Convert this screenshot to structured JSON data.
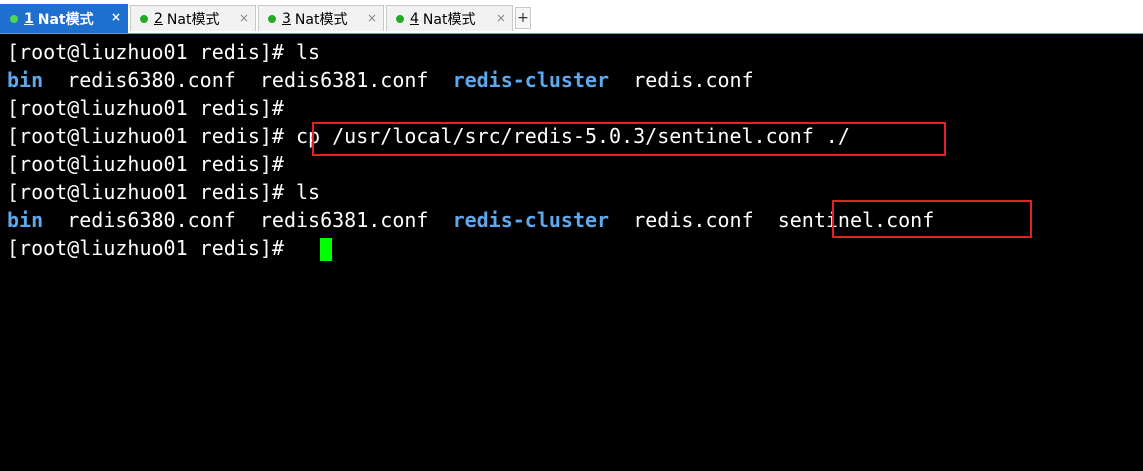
{
  "tabs": [
    {
      "num": "1",
      "label": "Nat模式",
      "dot_color": "#4cd94c",
      "active": true
    },
    {
      "num": "2",
      "label": "Nat模式",
      "dot_color": "#22aa22",
      "active": false
    },
    {
      "num": "3",
      "label": "Nat模式",
      "dot_color": "#22aa22",
      "active": false
    },
    {
      "num": "4",
      "label": "Nat模式",
      "dot_color": "#22aa22",
      "active": false
    }
  ],
  "close_glyph": "×",
  "add_tab_glyph": "+",
  "terminal": {
    "prompt": "[root@liuzhuo01 redis]# ",
    "cmd_ls": "ls",
    "cmd_cp": "cp /usr/local/src/redis-5.0.3/sentinel.conf ./",
    "listing1": {
      "bin": "bin",
      "f1": "redis6380.conf",
      "f2": "redis6381.conf",
      "d1": "redis-cluster",
      "f3": "redis.conf"
    },
    "listing2": {
      "bin": "bin",
      "f1": "redis6380.conf",
      "f2": "redis6381.conf",
      "d1": "redis-cluster",
      "f3": "redis.conf",
      "f4": "sentinel.conf"
    }
  }
}
